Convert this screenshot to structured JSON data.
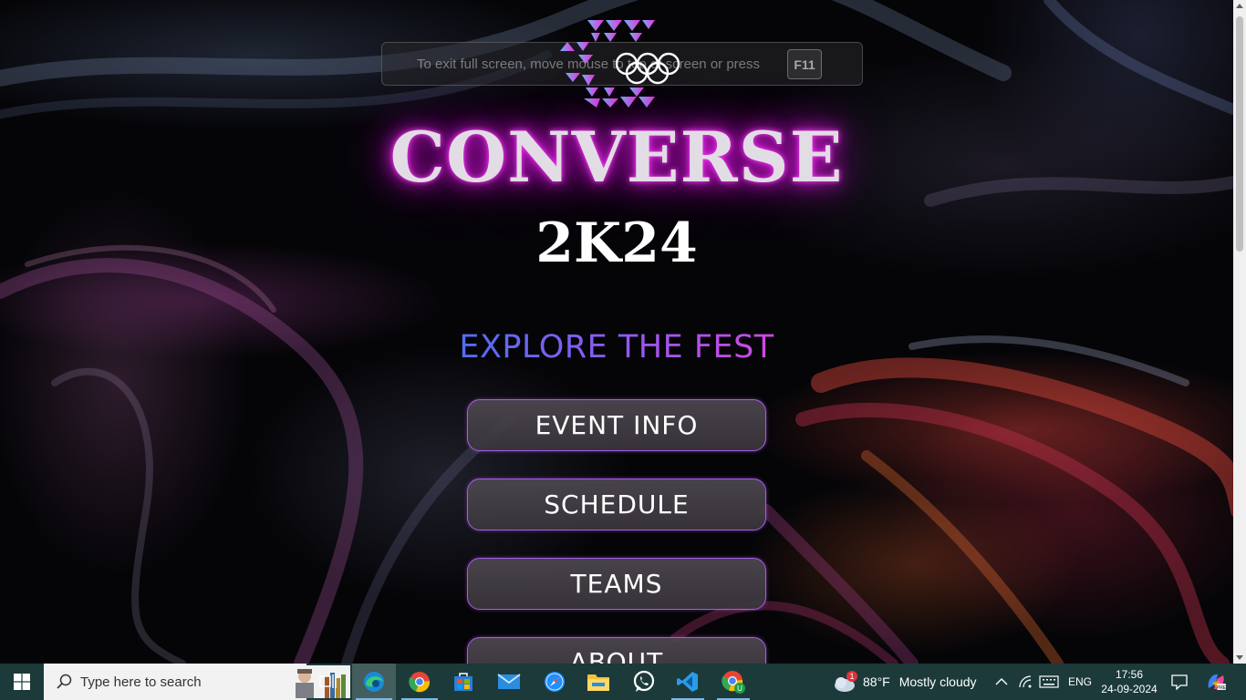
{
  "fullscreen_notice": {
    "text": "To exit full screen, move mouse to top of screen or press",
    "key": "F11"
  },
  "hero": {
    "title": "CONVERSE",
    "subtitle": "2K24",
    "tagline": "EXPLORE THE FEST"
  },
  "menu": {
    "event_info": "EVENT INFO",
    "schedule": "SCHEDULE",
    "teams": "TEAMS",
    "about": "ABOUT"
  },
  "colors": {
    "glow": "#e020e0",
    "button_border": "#a060e8",
    "tagline_start": "#4f6ef0",
    "tagline_end": "#d048e0",
    "taskbar": "#1c3a3a"
  },
  "taskbar": {
    "search_placeholder": "Type here to search",
    "apps": [
      "task-view-icon",
      "edge-icon",
      "chrome-icon",
      "store-icon",
      "mail-icon",
      "safari-icon",
      "file-explorer-icon",
      "whatsapp-icon",
      "vscode-icon",
      "chrome-profile-icon"
    ],
    "weather": {
      "badge": "1",
      "temperature": "88°F",
      "condition": "Mostly cloudy"
    },
    "language": "ENG",
    "time": "17:56",
    "date": "24-09-2024"
  }
}
